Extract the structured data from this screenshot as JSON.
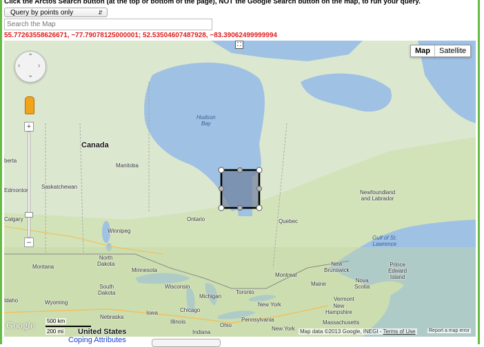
{
  "instructions": "Click the Arctos Search button (at the top or bottom of the page), NOT the Google Search button on the map, to run your query.",
  "query_select": {
    "value": "Query by points only"
  },
  "search": {
    "placeholder": "Search the Map"
  },
  "coords": "55.77263558626671, −77.79078125000001; 52.53504607487928, −83.39062499999994",
  "map": {
    "type_buttons": [
      "Map",
      "Satellite"
    ],
    "labels": {
      "hudson_bay": "Hudson\nBay",
      "canada": "Canada",
      "alberta": "berta",
      "manitoba": "Manitoba",
      "saskatchewan": "Saskatchewan",
      "edmonton": "Edmonton",
      "calgary": "Calgary",
      "winnipeg": "Winnipeg",
      "ontario": "Ontario",
      "quebec": "Quebec",
      "newfoundland": "Newfoundland\nand Labrador",
      "gulf": "Gulf of St.\nLawrence",
      "montana": "Montana",
      "north_dakota": "North\nDakota",
      "minnesota": "Minnesota",
      "south_dakota": "South\nDakota",
      "wisconsin": "Wisconsin",
      "michigan": "Michigan",
      "toronto": "Toronto",
      "montreal": "Montreal",
      "new_brunswick": "New\nBrunswick",
      "prince_edward": "Prince\nEdward\nIsland",
      "nova_scotia": "Nova\nScotia",
      "maine": "Maine",
      "vermont": "Vermont",
      "new_hampshire": "New\nHampshire",
      "massachusetts": "Massachusetts",
      "new_york_state": "New York",
      "new_york_city": "New York",
      "pennsylvania": "Pennsylvania",
      "ohio": "Ohio",
      "illinois": "Illinois",
      "indiana": "Indiana",
      "iowa": "Iowa",
      "chicago": "Chicago",
      "nebraska": "Nebraska",
      "wyoming": "Wyoming",
      "idaho": "Idaho",
      "united_states": "United States"
    },
    "scale": {
      "km": "500 km",
      "mi": "200 mi"
    },
    "logo": "Google",
    "attribution": "Map data ©2013 Google, INEGI - ",
    "terms": "Terms of Use",
    "report": "Report a map error",
    "colors": {
      "land": "#cfe0b4",
      "land_north": "#e9ede0",
      "water": "#9fc1e4",
      "selection": "#000000",
      "coords": "#e02020",
      "frame": "#66bb44"
    }
  },
  "footer": {
    "link": "Coping Attributes"
  }
}
